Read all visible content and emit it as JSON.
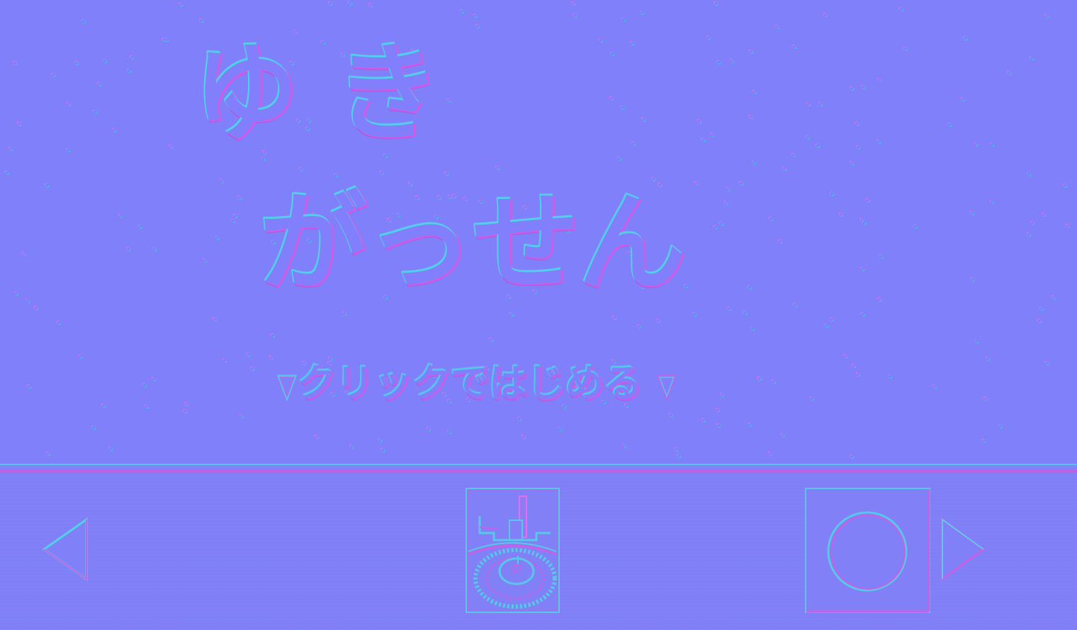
{
  "title": {
    "line1": "ゆき",
    "line2": "がっせん"
  },
  "start_prompt": "クリックではじめる",
  "toolbar": {
    "prev_icon": "left-triangle-icon",
    "center_icon": "snow-castle-eye-icon",
    "ok_icon": "circle-icon",
    "next_icon": "right-triangle-icon"
  },
  "colors": {
    "base": "#8080fb",
    "highlight": "#4fd2e8",
    "shadow": "#d25ae8"
  }
}
